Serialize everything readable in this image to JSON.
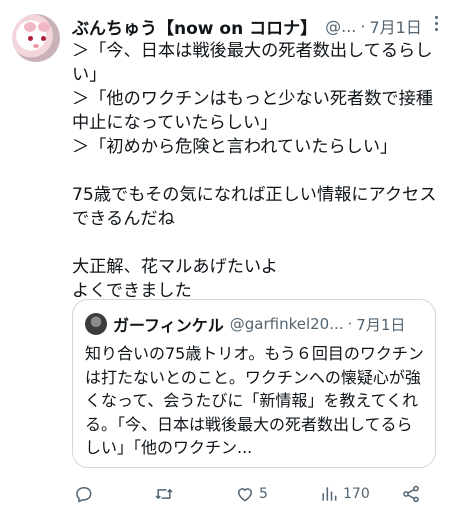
{
  "tweet": {
    "author_name": "ぶんちゅう【now on コロナ】",
    "handle": "@...",
    "separator": "·",
    "time": "7月1日",
    "text": "＞「今、日本は戦後最大の死者数出してるらしい」\n＞「他のワクチンはもっと少ない死者数で接種中止になっていたらしい」\n＞「初めから危険と言われていたらしい」\n\n75歳でもその気になれば正しい情報にアクセスできるんだね\n\n大正解、花マルあげたいよ\nよくできました"
  },
  "quoted_tweet": {
    "author_name": "ガーフィンケル",
    "handle": "@garfinkel20...",
    "separator": "·",
    "time": "7月1日",
    "text": "知り合いの75歳トリオ。もう６回目のワクチンは打たないとのこと。ワクチンへの懐疑心が強くなって、会うたびに「新情報」を教えてくれる。「今、日本は戦後最大の死者数出してるらしい」「他のワクチン..."
  },
  "actions": {
    "reply_count": "",
    "retweet_count": "",
    "like_count": "5",
    "views_count": "170"
  },
  "icons": [
    "more-icon",
    "reply-icon",
    "retweet-icon",
    "like-icon",
    "views-icon",
    "share-icon"
  ],
  "colors": {
    "text": "#0f1419",
    "secondary": "#536471",
    "border": "#cfd9de"
  }
}
